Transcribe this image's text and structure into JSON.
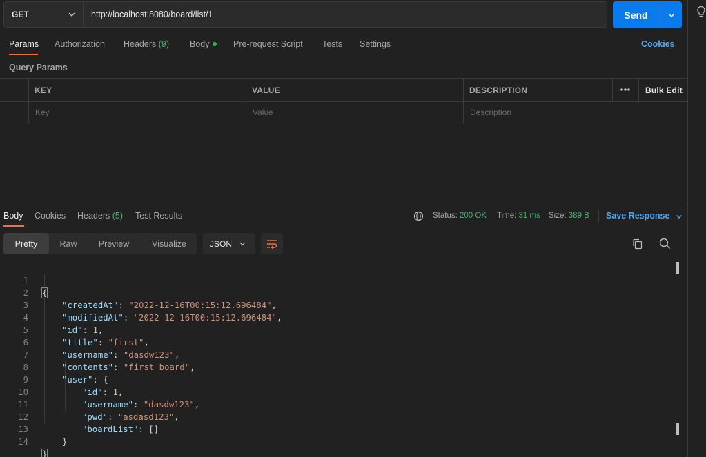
{
  "request": {
    "method": "GET",
    "url": "http://localhost:8080/board/list/1",
    "send_label": "Send"
  },
  "request_tabs": {
    "params": "Params",
    "authorization": "Authorization",
    "headers": "Headers",
    "headers_count": "(9)",
    "body": "Body",
    "pre_request": "Pre-request Script",
    "tests": "Tests",
    "settings": "Settings",
    "cookies": "Cookies"
  },
  "query_params": {
    "label": "Query Params",
    "columns": {
      "key": "KEY",
      "value": "VALUE",
      "description": "DESCRIPTION"
    },
    "bulk_edit": "Bulk Edit",
    "placeholders": {
      "key": "Key",
      "value": "Value",
      "description": "Description"
    }
  },
  "response_tabs": {
    "body": "Body",
    "cookies": "Cookies",
    "headers": "Headers",
    "headers_count": "(5)",
    "test_results": "Test Results"
  },
  "response_status": {
    "status_label": "Status:",
    "status_value": "200 OK",
    "time_label": "Time:",
    "time_value": "31 ms",
    "size_label": "Size:",
    "size_value": "389 B",
    "save_response": "Save Response"
  },
  "formats": {
    "pretty": "Pretty",
    "raw": "Raw",
    "preview": "Preview",
    "visualize": "Visualize",
    "language": "JSON"
  },
  "code": {
    "line_numbers": [
      "1",
      "2",
      "3",
      "4",
      "5",
      "6",
      "7",
      "8",
      "9",
      "10",
      "11",
      "12",
      "13",
      "14"
    ],
    "brace_open": "{",
    "brace_close": "}",
    "created_key": "\"createdAt\"",
    "created_val": "\"2022-12-16T00:15:12.696484\"",
    "modified_key": "\"modifiedAt\"",
    "modified_val": "\"2022-12-16T00:15:12.696484\"",
    "id_key": "\"id\"",
    "id_val": "1",
    "title_key": "\"title\"",
    "title_val": "\"first\"",
    "username_key": "\"username\"",
    "username_val": "\"dasdw123\"",
    "contents_key": "\"contents\"",
    "contents_val": "\"first board\"",
    "user_key": "\"user\"",
    "user_id_key": "\"id\"",
    "user_id_val": "1",
    "user_username_key": "\"username\"",
    "user_username_val": "\"dasdw123\"",
    "user_pwd_key": "\"pwd\"",
    "user_pwd_val": "\"asdasd123\"",
    "user_boardlist_key": "\"boardList\"",
    "user_boardlist_val": "[]"
  },
  "colors": {
    "accent": "#ff6c37",
    "send": "#097bed",
    "link": "#4ca8f5",
    "status_ok": "#49b06f"
  },
  "icons": [
    "chevron-down-icon",
    "globe-icon",
    "wrap-lines-icon",
    "copy-icon",
    "search-icon",
    "more-icon",
    "lightbulb-icon"
  ]
}
